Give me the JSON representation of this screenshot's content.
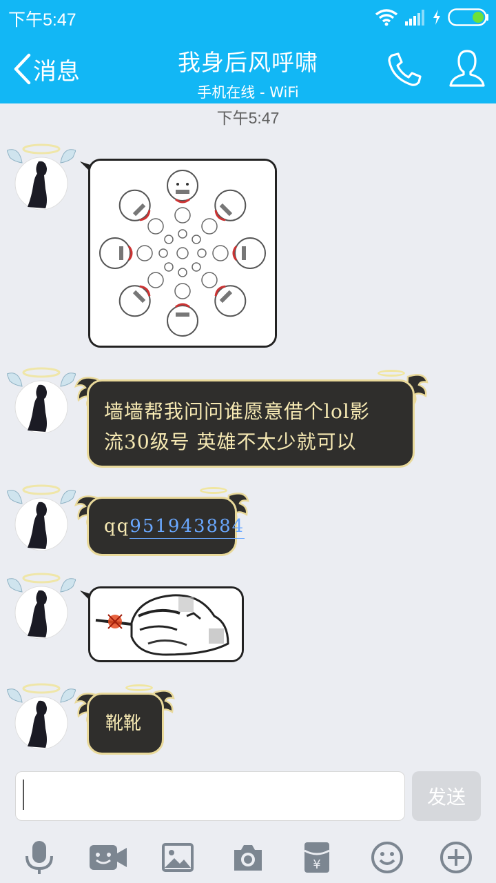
{
  "status_bar": {
    "time": "下午5:47"
  },
  "header": {
    "back_label": "消息",
    "title": "我身后风呼啸",
    "subtitle": "手机在线 - WiFi"
  },
  "timestamp": "下午5:47",
  "messages": [
    {
      "type": "image",
      "description_icon": "sticker-image-icon"
    },
    {
      "type": "text",
      "text_line1": "墙墙帮我问问谁愿意借个lol影",
      "text_line2": "流30级号 英雄不太少就可以"
    },
    {
      "type": "text",
      "prefix": "qq",
      "link": "951943884"
    },
    {
      "type": "image",
      "description_icon": "meme-image-icon"
    },
    {
      "type": "text",
      "text": "靴靴"
    }
  ],
  "input": {
    "value": "",
    "placeholder": ""
  },
  "send_label": "发送",
  "toolbar": [
    "mic-icon",
    "video-icon",
    "image-icon",
    "camera-icon",
    "red-packet-icon",
    "emoji-icon",
    "plus-icon"
  ],
  "colors": {
    "accent": "#12b7f5",
    "bubble_dark": "#2f2e2c",
    "bubble_text": "#f6e9b3",
    "link": "#6aa8ff"
  }
}
